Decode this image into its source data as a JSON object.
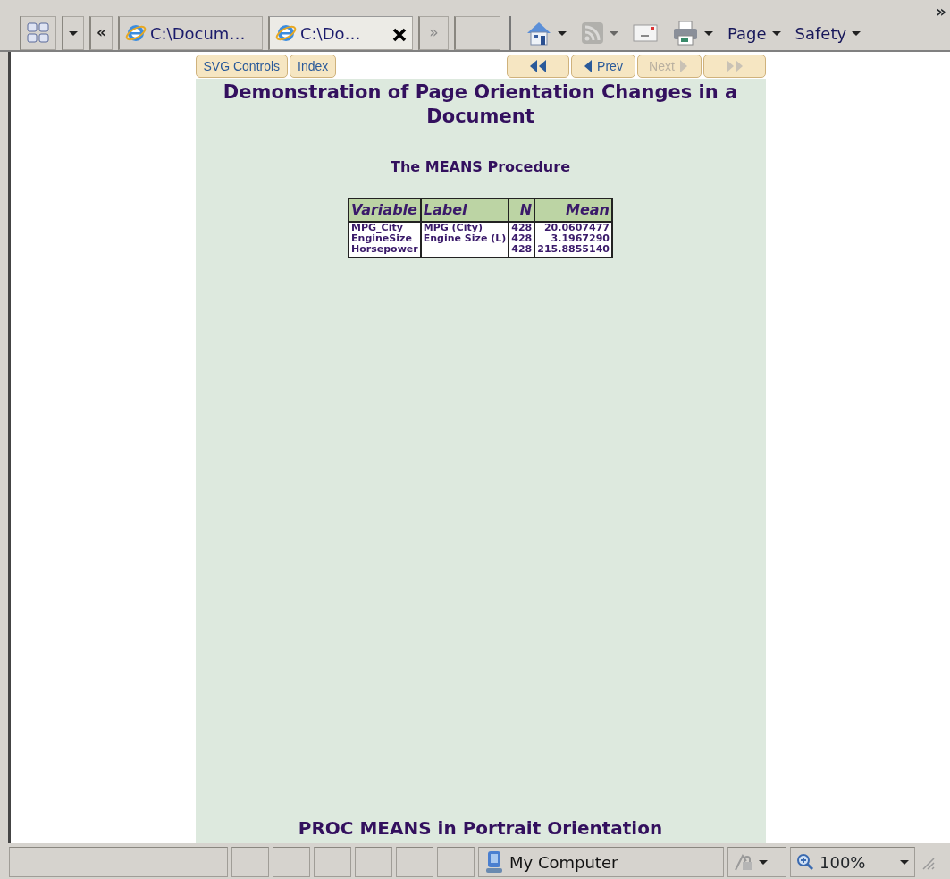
{
  "toolbar": {
    "back_label": "«",
    "tabs": [
      {
        "label": "C:\\Docum…",
        "selected": false
      },
      {
        "label": "C:\\Do…",
        "selected": true
      }
    ],
    "more_tabs_label": "»",
    "feeds": {
      "disabled": true
    },
    "menus": [
      {
        "label": "Page"
      },
      {
        "label": "Safety"
      }
    ],
    "overflow_label": "»"
  },
  "page": {
    "nav_links": [
      {
        "label": "SVG Controls"
      },
      {
        "label": "Index"
      }
    ],
    "pager": [
      {
        "kind": "first",
        "disabled": false
      },
      {
        "kind": "prev",
        "label": "Prev",
        "disabled": false
      },
      {
        "kind": "next",
        "label": "Next",
        "disabled": true
      },
      {
        "kind": "last",
        "disabled": true
      }
    ],
    "title": "Demonstration of Page Orientation Changes in a Document",
    "procedure_title": "The MEANS Procedure",
    "table": {
      "columns": [
        "Variable",
        "Label",
        "N",
        "Mean"
      ],
      "rows": [
        [
          "MPG_City",
          "MPG (City)",
          "428",
          "20.0607477"
        ],
        [
          "EngineSize",
          "Engine Size (L)",
          "428",
          "3.1967290"
        ],
        [
          "Horsepower",
          "",
          "428",
          "215.8855140"
        ]
      ]
    },
    "footer_title": "PROC MEANS in Portrait Orientation"
  },
  "status_bar": {
    "zone": "My Computer",
    "zoom": "100%"
  }
}
